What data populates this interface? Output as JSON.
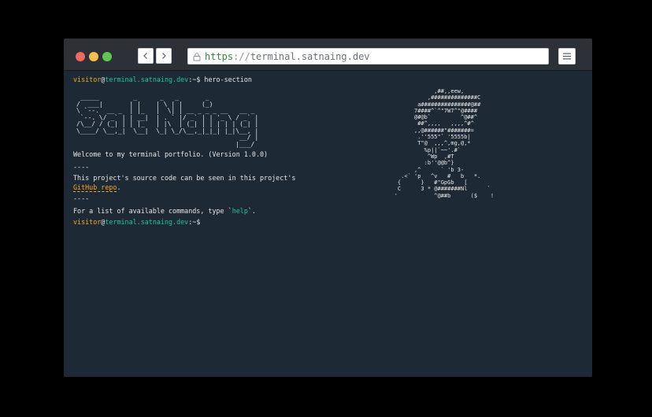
{
  "window": {
    "url_scheme": "https",
    "url_separator": "://",
    "url_host": "terminal.satnaing.dev"
  },
  "icons": {
    "back": "chevron-left-icon",
    "forward": "chevron-right-icon",
    "lock": "lock-icon",
    "menu": "hamburger-menu-icon"
  },
  "prompt": {
    "user": "visitor",
    "at": "@",
    "host": "terminal.satnaing.dev",
    "suffix": ":~$ "
  },
  "history": {
    "command": "hero-section"
  },
  "banner": " _____         _      _   _       _             \n/  ___|       | |    | \\ | |     (_)            \n\\ `--.  __ _  | |_   |  \\| | __ _ _ _ __   __ _ \n `--. \\/ _` | | __|  | . ` |/ _` | | '_ \\ / _` |\n/\\__/ / (_| | | |_   | |\\  | (_| | | | | | (_| |\n\\____/ \\__,_|  \\__|  \\_| \\_/\\__,_|_|_| |_|\\__, |\n                                           __/ |\n                                          |___/ ",
  "ascii_art": "                    ,##,,eew,\n                  ,##############C\n               a###############@##\n              7####^`^\"7W7^\"@####\n              @#@b`         ^@##^\n               ##^,,,,   ,,,,^#^\n              ,,@######\"#######=\n               .''555\"` '5555b|\n               T\"@  ,,,^,mg,@,*\n                 %p||`~~'.#`\n                  ^Wp  ,#T\n                 :b''@@b^}\n              ,^      ` 'b 3-\n          .<` 'p   ^v   #   b   *.\n         {      }   #\"GpGb   [\n         C      3 * @#######Nl      `\n        '           ^@##b      ($    !",
  "output": {
    "welcome": "Welcome to my terminal portfolio. (Version 1.0.0)",
    "divider": "----",
    "source_prefix": "This project's source code can be seen in this project's",
    "repo_link": "GitHub repo",
    "repo_suffix": ".",
    "help_prefix": "For a list of available commands, type `",
    "help_cmd": "help",
    "help_suffix": "`."
  },
  "colors": {
    "background": "#1d2a35",
    "titlebar": "#2b3137",
    "accent_orange": "#f5a623",
    "accent_teal": "#1ec3a3"
  }
}
